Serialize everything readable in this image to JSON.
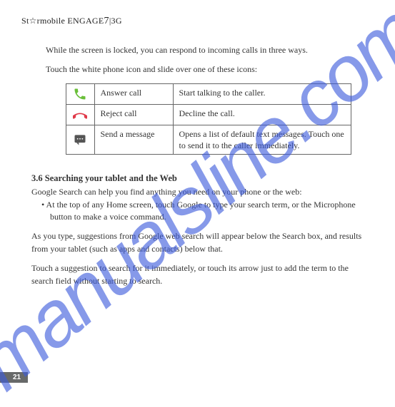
{
  "header": {
    "brand": "St☆rmobile",
    "model_prefix": "ENGAGE",
    "model_seven": "7",
    "model_suffix": "|3G"
  },
  "intro": {
    "p1": "While the screen is locked, you can respond to incoming calls in three ways.",
    "p2": "Touch the white phone icon and slide over one of these icons:"
  },
  "call_table": {
    "rows": [
      {
        "icon": "phone-answer-icon",
        "action": "Answer call",
        "desc": "Start talking to the caller."
      },
      {
        "icon": "phone-reject-icon",
        "action": "Reject call",
        "desc": "Decline the call."
      },
      {
        "icon": "message-icon",
        "action": "Send a message",
        "desc": "Opens a list of default text messages. Touch one to send it to the caller immediately."
      }
    ]
  },
  "section": {
    "title": "3.6 Searching your tablet and the Web",
    "p1": "Google Search can help you find anything you need on your phone or the web:",
    "bullet": "• At the top of any Home screen, touch Google to type your search term, or the Microphone button to make a voice command.",
    "p2": "As you type, suggestions from Google web search will appear below the Search box, and results from your tablet (such as apps and contacts) below that.",
    "p3": "Touch a suggestion to search for it immediately, or touch its arrow just to add the term to the search field without starting to search."
  },
  "page_number": "21",
  "watermark": "manualsline.com"
}
